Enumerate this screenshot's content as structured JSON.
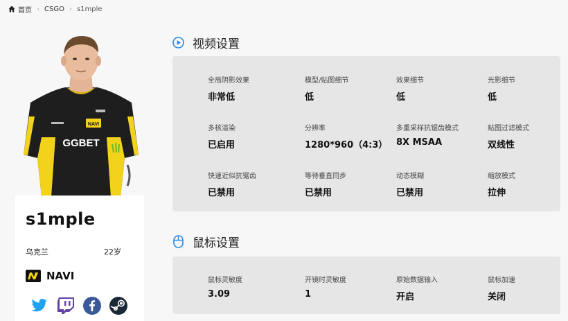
{
  "breadcrumb": {
    "home": "首页",
    "game": "CSGO",
    "current": "s1mple"
  },
  "player": {
    "name": "s1mple",
    "country": "乌克兰",
    "age": "22岁",
    "team": "NAVI",
    "jersey_sponsor": "GGBET",
    "jersey_team_badge": "NAVI",
    "socials": [
      "twitter-icon",
      "twitch-icon",
      "facebook-icon",
      "steam-icon"
    ]
  },
  "video_settings": {
    "title": "视频设置",
    "icon": "play-circle-icon",
    "items": [
      {
        "label": "全局阴影效果",
        "value": "非常低"
      },
      {
        "label": "模型/贴图细节",
        "value": "低"
      },
      {
        "label": "效果细节",
        "value": "低"
      },
      {
        "label": "光影细节",
        "value": "低"
      },
      {
        "label": "多核渲染",
        "value": "已启用"
      },
      {
        "label": "分辨率",
        "value": "1280*960（4:3）"
      },
      {
        "label": "多重采样抗锯齿模式",
        "value": "8X MSAA"
      },
      {
        "label": "贴图过滤模式",
        "value": "双线性"
      },
      {
        "label": "快速近似抗锯齿",
        "value": "已禁用"
      },
      {
        "label": "等待垂直同步",
        "value": "已禁用"
      },
      {
        "label": "动态模糊",
        "value": "已禁用"
      },
      {
        "label": "缩放模式",
        "value": "拉伸"
      }
    ]
  },
  "mouse_settings": {
    "title": "鼠标设置",
    "icon": "mouse-icon",
    "items": [
      {
        "label": "鼠标灵敏度",
        "value": "3.09"
      },
      {
        "label": "开镜时灵敏度",
        "value": "1"
      },
      {
        "label": "原始数据输入",
        "value": "开启"
      },
      {
        "label": "鼠标加速",
        "value": "关闭"
      }
    ]
  },
  "colors": {
    "accent": "#2b8ae6",
    "panel_bg": "#e6e6e6",
    "page_bg": "#f7f7f7",
    "card_bg": "#ffffff"
  }
}
